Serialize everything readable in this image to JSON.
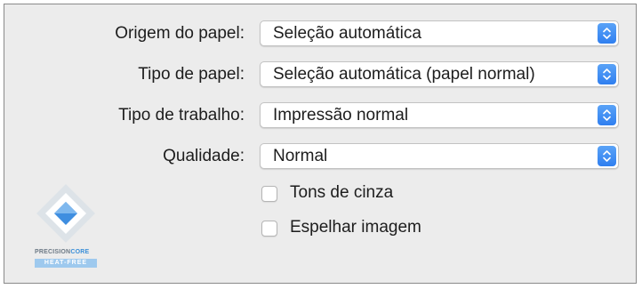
{
  "settings": {
    "paper_source": {
      "label": "Origem do papel:",
      "value": "Seleção automática"
    },
    "paper_type": {
      "label": "Tipo de papel:",
      "value": "Seleção automática (papel normal)"
    },
    "job_type": {
      "label": "Tipo de trabalho:",
      "value": "Impressão normal"
    },
    "quality": {
      "label": "Qualidade:",
      "value": "Normal"
    }
  },
  "options": {
    "grayscale": {
      "label": "Tons de cinza",
      "checked": false
    },
    "mirror_image": {
      "label": "Espelhar imagem",
      "checked": false
    }
  },
  "logo": {
    "line1_part1": "PRECISION",
    "line1_part2": "CORE",
    "line2": "HEAT-FREE",
    "icon": "precisioncore-diamond-logo"
  },
  "colors": {
    "accent": "#2f7ff0",
    "panel_bg": "#ececec"
  }
}
